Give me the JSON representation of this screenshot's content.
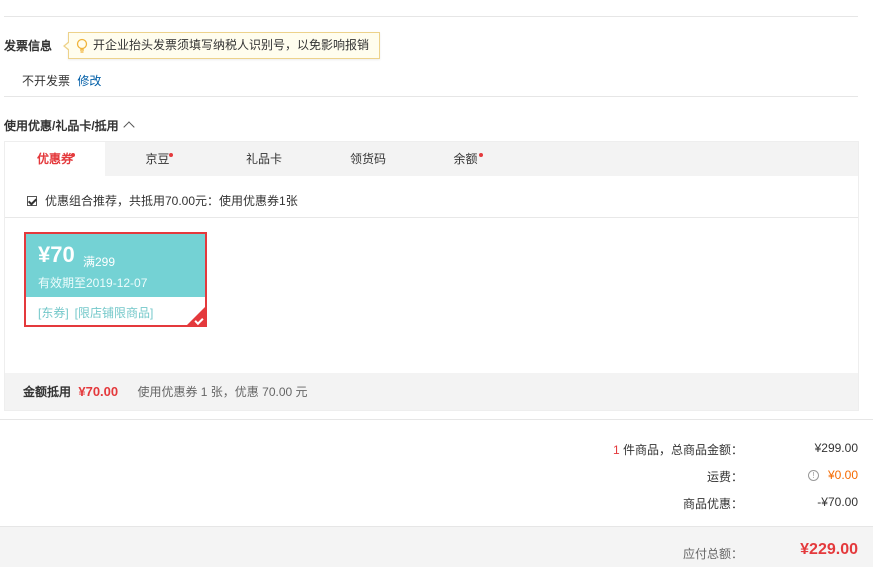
{
  "invoice": {
    "title": "发票信息",
    "tip": "开企业抬头发票须填写纳税人识别号，以免影响报销",
    "status": "不开发票",
    "modify": "修改"
  },
  "coupon_section": {
    "title": "使用优惠/礼品卡/抵用",
    "tabs": [
      {
        "label": "优惠券",
        "dot": true,
        "active": true
      },
      {
        "label": "京豆",
        "dot": true,
        "active": false
      },
      {
        "label": "礼品卡",
        "dot": false,
        "active": false
      },
      {
        "label": "领货码",
        "dot": false,
        "active": false
      },
      {
        "label": "余额",
        "dot": true,
        "active": false
      }
    ],
    "combo_text": "优惠组合推荐，共抵用70.00元：使用优惠券1张",
    "combo_checked": true,
    "coupon": {
      "amount": "¥70",
      "condition": "满299",
      "valid": "有效期至2019-12-07",
      "tags": [
        "[东券]",
        "[限店铺限商品]"
      ],
      "selected": true
    },
    "summary": {
      "label": "金额抵用",
      "amount": "¥70.00",
      "desc": "使用优惠券 1 张，优惠 70.00 元"
    }
  },
  "totals": {
    "items_count": "1",
    "items_label": " 件商品，总商品金额：",
    "items_value": "¥299.00",
    "shipping_label": "运费：",
    "shipping_value": "¥0.00",
    "discount_label": "商品优惠：",
    "discount_value": "-¥70.00",
    "pay_label": "应付总额：",
    "pay_value": "¥229.00"
  },
  "colors": {
    "accent_red": "#e4393c",
    "coupon_teal": "#74d2d4",
    "link_blue": "#005ea7",
    "shipping_orange": "#f56a00"
  },
  "icons": [
    "lightbulb-icon",
    "chevron-up-icon",
    "checkmark-icon",
    "info-icon"
  ]
}
